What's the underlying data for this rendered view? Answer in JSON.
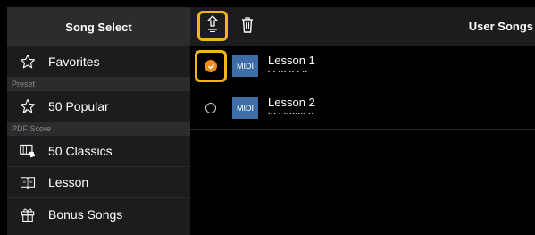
{
  "sidebar": {
    "title": "Song Select",
    "items": [
      {
        "label": "Favorites"
      },
      {
        "section": "Preset"
      },
      {
        "label": "50 Popular"
      },
      {
        "section": "PDF Score"
      },
      {
        "label": "50 Classics"
      },
      {
        "label": "Lesson"
      },
      {
        "label": "Bonus Songs"
      }
    ]
  },
  "toolbar": {
    "title": "User Songs"
  },
  "songs": [
    {
      "badge": "MIDI",
      "title": "Lesson 1",
      "subtitle": "▪ ▪ ▪▪▪ ▪▪ ▪ ▪▪",
      "selected": true
    },
    {
      "badge": "MIDI",
      "title": "Lesson 2",
      "subtitle": "▪▪▪ ▪ ▪▪▪▪▪▪▪▪ ▪▪",
      "selected": false
    }
  ],
  "colors": {
    "highlight": "#f4b51c",
    "check": "#f08a1e",
    "badge": "#3e6ea8"
  }
}
